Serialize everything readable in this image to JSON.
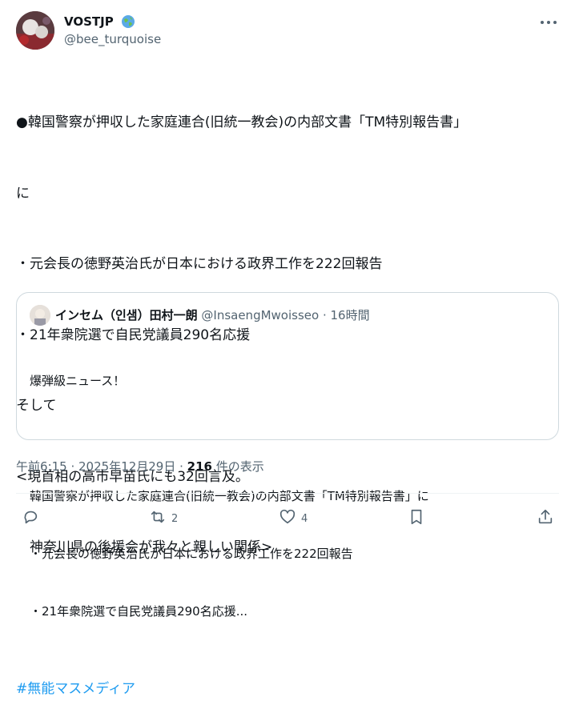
{
  "author": {
    "display_name": "VOSTJP",
    "handle": "@bee_turquoise",
    "badge_icon": "globe-icon"
  },
  "post": {
    "lines": [
      "●韓国警察が押収した家庭連合(旧統一教会)の内部文書「TM特別報告書」",
      "に",
      "・元会長の徳野英治氏が日本における政界工作を222回報告",
      "・21年衆院選で自民党議員290名応援",
      "そして",
      "<現首相の高市早苗氏にも32回言及。",
      "　神奈川県の後援会が我々と親しい関係>",
      ""
    ],
    "hashtag": "#無能マスメディア"
  },
  "quote": {
    "name": "インセム（인샘）田村一朗",
    "handle": "@InsaengMwoisseo",
    "time": "· 16時間",
    "lines": [
      "爆弾級ニュース！",
      "",
      "韓国警察が押収した家庭連合(旧統一教会)の内部文書「TM特別報告書」に",
      "・元会長の徳野英治氏が日本における政界工作を222回報告",
      "・21年衆院選で自民党議員290名応援..."
    ]
  },
  "meta": {
    "timestamp": "午前6:15 · 2025年12月29日 · ",
    "views_count": "216",
    "views_label": " 件の表示"
  },
  "actions": {
    "reply_count": "",
    "repost_count": "2",
    "like_count": "4"
  },
  "colors": {
    "accent": "#1d9bf0",
    "secondary_text": "#536471",
    "border": "#cfd9de"
  }
}
